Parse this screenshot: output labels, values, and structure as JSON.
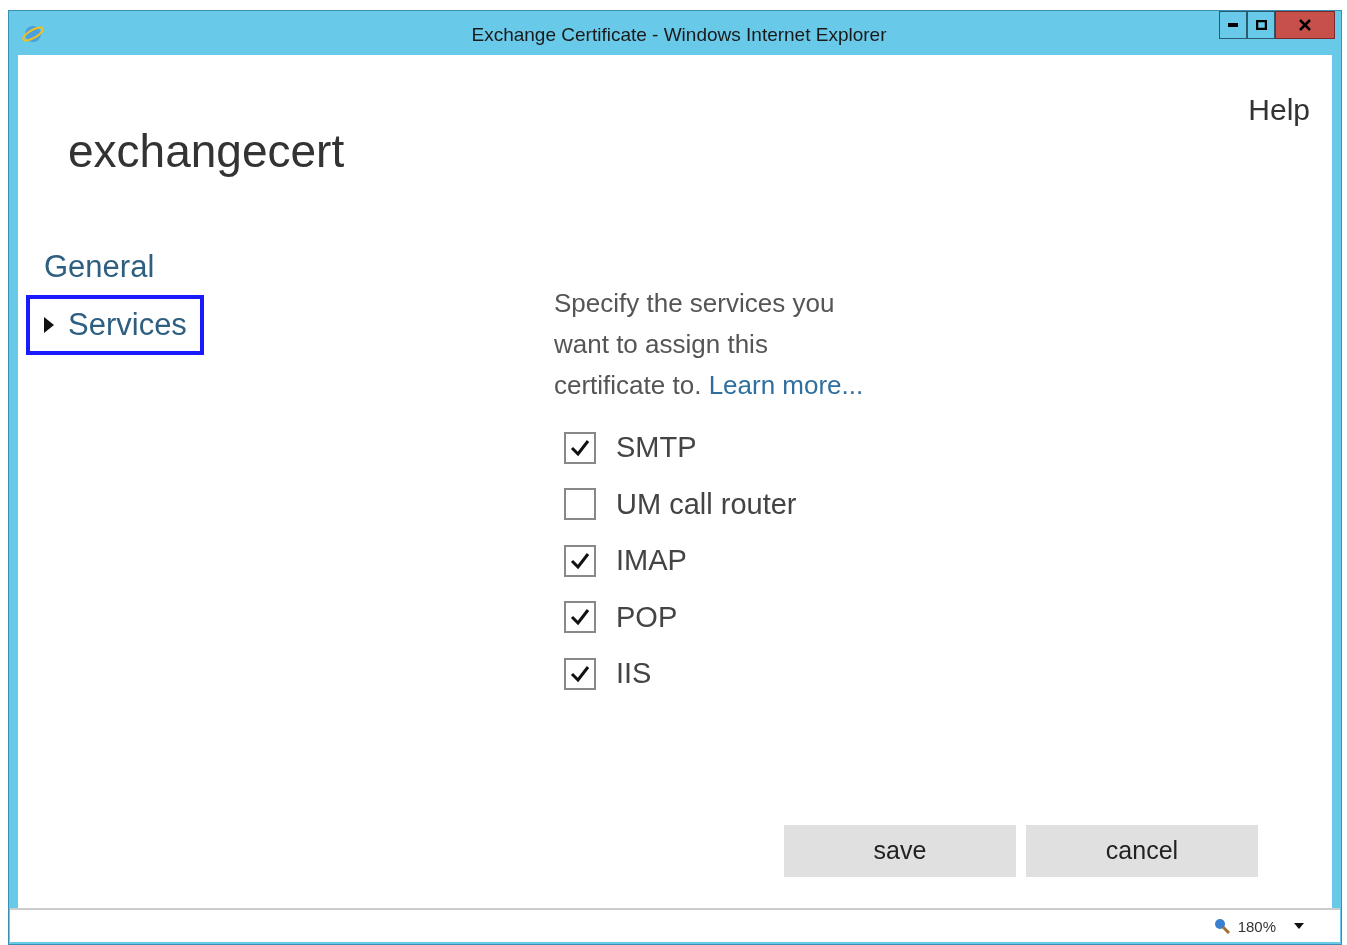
{
  "window": {
    "title": "Exchange Certificate - Windows Internet Explorer"
  },
  "header": {
    "title": "exchangecert",
    "help": "Help"
  },
  "nav": [
    {
      "label": "General",
      "selected": false,
      "highlighted": false
    },
    {
      "label": "Services",
      "selected": true,
      "highlighted": true
    }
  ],
  "description": "Specify the services you want to assign this certificate to.",
  "learn_more": "Learn more...",
  "services": [
    {
      "label": "SMTP",
      "checked": true
    },
    {
      "label": "UM call router",
      "checked": false
    },
    {
      "label": "IMAP",
      "checked": true
    },
    {
      "label": "POP",
      "checked": true
    },
    {
      "label": "IIS",
      "checked": true
    }
  ],
  "buttons": [
    "save",
    "cancel"
  ],
  "status_bar": {
    "zoom": "180%"
  }
}
